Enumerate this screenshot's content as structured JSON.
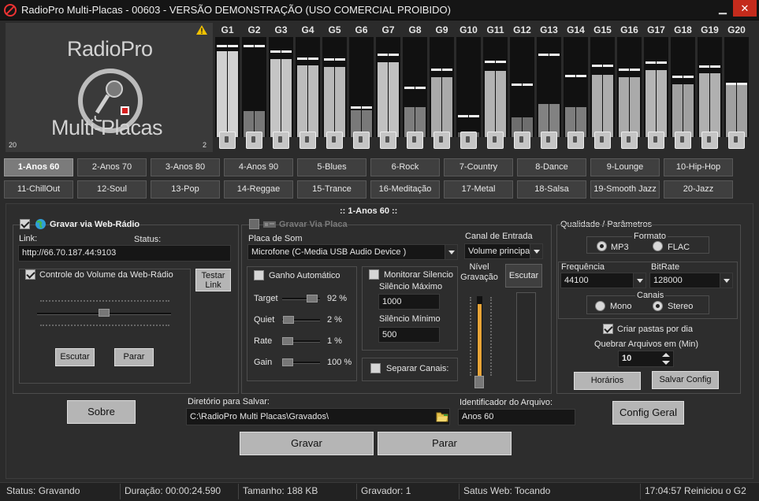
{
  "window": {
    "title": "RadioPro Multi-Placas - 00603 - VERSÃO DEMONSTRAÇÃO (USO COMERCIAL PROIBIDO)",
    "minimize_glyph": "▁",
    "close_glyph": "✕"
  },
  "logo": {
    "line1": "RadioPro",
    "line2": "Multi-Placas",
    "corner_left": "20",
    "corner_right": "2"
  },
  "meters": [
    {
      "label": "G1",
      "level": 0.86,
      "peak": 0.9
    },
    {
      "label": "G2",
      "level": 0.26,
      "peak": 0.9
    },
    {
      "label": "G3",
      "level": 0.78,
      "peak": 0.84
    },
    {
      "label": "G4",
      "level": 0.72,
      "peak": 0.77
    },
    {
      "label": "G5",
      "level": 0.7,
      "peak": 0.76
    },
    {
      "label": "G6",
      "level": 0.27,
      "peak": 0.28
    },
    {
      "label": "G7",
      "level": 0.75,
      "peak": 0.81
    },
    {
      "label": "G8",
      "level": 0.3,
      "peak": 0.48
    },
    {
      "label": "G9",
      "level": 0.6,
      "peak": 0.66
    },
    {
      "label": "G10",
      "level": 0.05,
      "peak": 0.2
    },
    {
      "label": "G11",
      "level": 0.66,
      "peak": 0.74
    },
    {
      "label": "G12",
      "level": 0.2,
      "peak": 0.51
    },
    {
      "label": "G13",
      "level": 0.33,
      "peak": 0.81
    },
    {
      "label": "G14",
      "level": 0.3,
      "peak": 0.6
    },
    {
      "label": "G15",
      "level": 0.62,
      "peak": 0.7
    },
    {
      "label": "G16",
      "level": 0.6,
      "peak": 0.66
    },
    {
      "label": "G17",
      "level": 0.67,
      "peak": 0.73
    },
    {
      "label": "G18",
      "level": 0.53,
      "peak": 0.59
    },
    {
      "label": "G19",
      "level": 0.64,
      "peak": 0.69
    },
    {
      "label": "G20",
      "level": 0.53,
      "peak": 0.52
    }
  ],
  "presets": {
    "row1": [
      "1-Anos 60",
      "2-Anos 70",
      "3-Anos 80",
      "4-Anos 90",
      "5-Blues",
      "6-Rock",
      "7-Country",
      "8-Dance",
      "9-Lounge",
      "10-Hip-Hop"
    ],
    "row2": [
      "11-ChillOut",
      "12-Soul",
      "13-Pop",
      "14-Reggae",
      "15-Trance",
      "16-Meditação",
      "17-Metal",
      "18-Salsa",
      "19-Smooth Jazz",
      "20-Jazz"
    ],
    "active_index": 0
  },
  "current_preset": "::   1-Anos 60   ::",
  "webradio": {
    "title": "Gravar via Web-Rádio",
    "link_label": "Link:",
    "status_label": "Status:",
    "link_value": "http://66.70.187.44:9103",
    "volume_control_label": "Controle do Volume da Web-Rádio",
    "volume": 0.5,
    "test_link": "Testar Link",
    "listen": "Escutar",
    "stop": "Parar"
  },
  "card": {
    "title": "Gravar Via Placa",
    "sound_card_label": "Placa de Som",
    "sound_card_value": "Microfone (C-Media USB Audio Device  )",
    "auto_gain_label": "Ganho Automático",
    "sliders": [
      {
        "label": "Target",
        "value": "92 %",
        "level": 0.92
      },
      {
        "label": "Quiet",
        "value": "2 %",
        "level": 0.02
      },
      {
        "label": "Rate",
        "value": "1 %",
        "level": 0.01
      },
      {
        "label": "Gain",
        "value": "100 %",
        "level": 0.0
      }
    ],
    "monitor_silence_label": "Monitorar Silencio",
    "max_silence_label": "Silêncio Máximo",
    "max_silence_value": "1000",
    "min_silence_label": "Silêncio Mínimo",
    "min_silence_value": "500",
    "split_channels_label": "Separar Canais:",
    "input_channel_label": "Canal de Entrada",
    "input_channel_value": "Volume principal",
    "rec_level_label": "Nível Gravação",
    "rec_level": 0.9,
    "listen": "Escutar"
  },
  "quality": {
    "title": "Qualidade / Parâmetros",
    "format_label": "Formato",
    "format_options": [
      "MP3",
      "FLAC"
    ],
    "format_selected": "MP3",
    "frequency_label": "Frequência",
    "frequency_value": "44100",
    "bitrate_label": "BitRate",
    "bitrate_value": "128000",
    "channels_label": "Canais",
    "channel_options": [
      "Mono",
      "Stereo"
    ],
    "channel_selected": "Stereo",
    "daily_folders_label": "Criar pastas por dia",
    "split_files_label": "Quebrar Arquivos em (Min)",
    "split_files_value": "10",
    "schedules_button": "Horários",
    "save_config_button": "Salvar Config"
  },
  "bottom": {
    "about_button": "Sobre",
    "save_dir_label": "Diretório para Salvar:",
    "save_dir_value": "C:\\RadioPro Multi Placas\\Gravados\\",
    "file_id_label": "Identificador do Arquivo:",
    "file_id_value": "Anos 60",
    "general_config_button": "Config Geral",
    "record_button": "Gravar",
    "stop_button": "Parar"
  },
  "status": {
    "status": "Status: Gravando",
    "duration": "Duração: 00:00:24.590",
    "size": "Tamanho: 188 KB",
    "recorder": "Gravador: 1",
    "web_status": "Satus Web: Tocando",
    "event": "17:04:57 Reiniciou o G2"
  }
}
